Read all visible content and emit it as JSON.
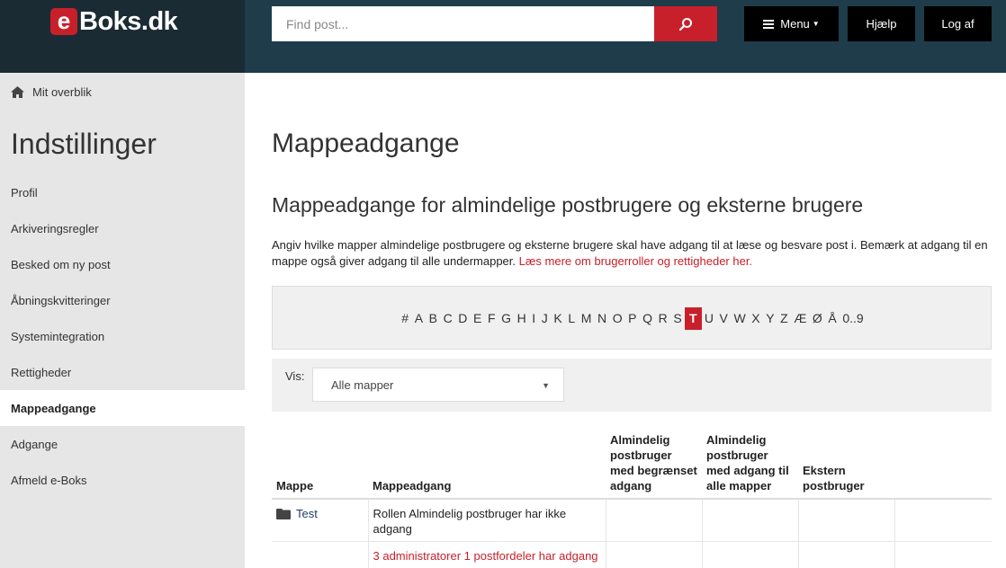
{
  "header": {
    "logo_e": "e",
    "logo_text": "Boks.dk",
    "search_placeholder": "Find post...",
    "menu_label": "Menu",
    "help_label": "Hjælp",
    "logout_label": "Log af"
  },
  "sidebar": {
    "breadcrumb": "Mit overblik",
    "title": "Indstillinger",
    "items": [
      {
        "label": "Profil"
      },
      {
        "label": "Arkiveringsregler"
      },
      {
        "label": "Besked om ny post"
      },
      {
        "label": "Åbningskvitteringer"
      },
      {
        "label": "Systemintegration"
      },
      {
        "label": "Rettigheder"
      },
      {
        "label": "Mappeadgange"
      },
      {
        "label": "Adgange"
      },
      {
        "label": "Afmeld e-Boks"
      }
    ],
    "active_item": "Mappeadgange"
  },
  "main": {
    "title": "Mappeadgange",
    "section_title": "Mappeadgange for almindelige postbrugere og eksterne brugere",
    "description": "Angiv hvilke mapper almindelige postbrugere og eksterne brugere skal have adgang til at læse og besvare post i. Bemærk at adgang til en mappe også giver adgang til alle undermapper.",
    "description_link": "Læs mere om brugerroller og rettigheder her.",
    "alphabet": [
      "#",
      "A",
      "B",
      "C",
      "D",
      "E",
      "F",
      "G",
      "H",
      "I",
      "J",
      "K",
      "L",
      "M",
      "N",
      "O",
      "P",
      "Q",
      "R",
      "S",
      "T",
      "U",
      "V",
      "W",
      "X",
      "Y",
      "Z",
      "Æ",
      "Ø",
      "Å",
      "0..9"
    ],
    "active_letter": "T",
    "filter": {
      "label": "Vis:",
      "selected": "Alle mapper"
    },
    "table": {
      "headers": {
        "folder": "Mappe",
        "access": "Mappeadgang",
        "col_limited": "Almindelig postbruger med begrænset adgang",
        "col_all": "Almindelig postbruger med adgang til alle mapper",
        "col_external": "Ekstern postbruger",
        "col_extra": ""
      },
      "rows": [
        {
          "folder": "Test",
          "access_text": "Rollen Almindelig postbruger har ikke adgang",
          "access_link": "3 administratorer 1 postfordeler har adgang"
        }
      ]
    }
  },
  "colors": {
    "brand_red": "#c8202b",
    "header_bg": "#1f3c4a",
    "header_left_bg": "#1b2b33",
    "sidebar_bg": "#e6e6e6"
  }
}
